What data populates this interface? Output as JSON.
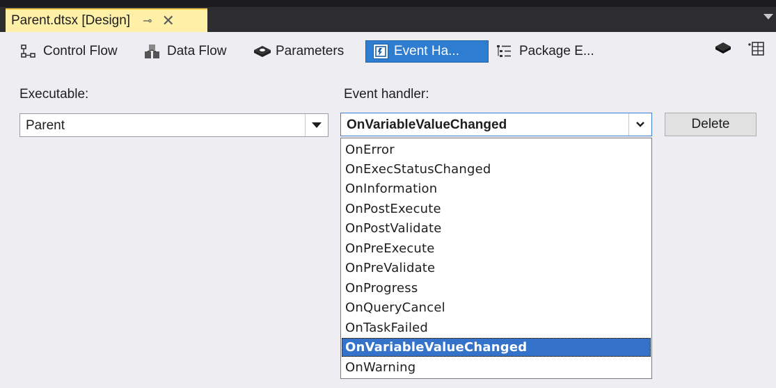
{
  "window": {
    "doc_tab_title": "Parent.dtsx [Design]",
    "pin_glyph": "⊸",
    "close_glyph": "✕"
  },
  "designer_tabs": [
    {
      "label": "Control Flow",
      "icon": "control-flow-icon"
    },
    {
      "label": "Data Flow",
      "icon": "data-flow-icon"
    },
    {
      "label": "Parameters",
      "icon": "parameters-icon"
    },
    {
      "label": "Event Ha...",
      "icon": "event-handlers-icon",
      "active": true
    },
    {
      "label": "Package E...",
      "icon": "package-explorer-icon"
    }
  ],
  "toolbar_right_icons": [
    "package-part-icon",
    "variables-grid-icon"
  ],
  "executable": {
    "label": "Executable:",
    "value": "Parent"
  },
  "event_handler": {
    "label": "Event handler:",
    "value": "OnVariableValueChanged",
    "options": [
      "OnError",
      "OnExecStatusChanged",
      "OnInformation",
      "OnPostExecute",
      "OnPostValidate",
      "OnPreExecute",
      "OnPreValidate",
      "OnProgress",
      "OnQueryCancel",
      "OnTaskFailed",
      "OnVariableValueChanged",
      "OnWarning"
    ],
    "selected_index": 10
  },
  "delete_button": {
    "label": "Delete"
  },
  "colors": {
    "doc_tab_bg": "#fff0a8",
    "active_tab_bg": "#2e7dd1",
    "selection_bg": "#3473c9",
    "titlebar_bg": "#2d2d30"
  }
}
